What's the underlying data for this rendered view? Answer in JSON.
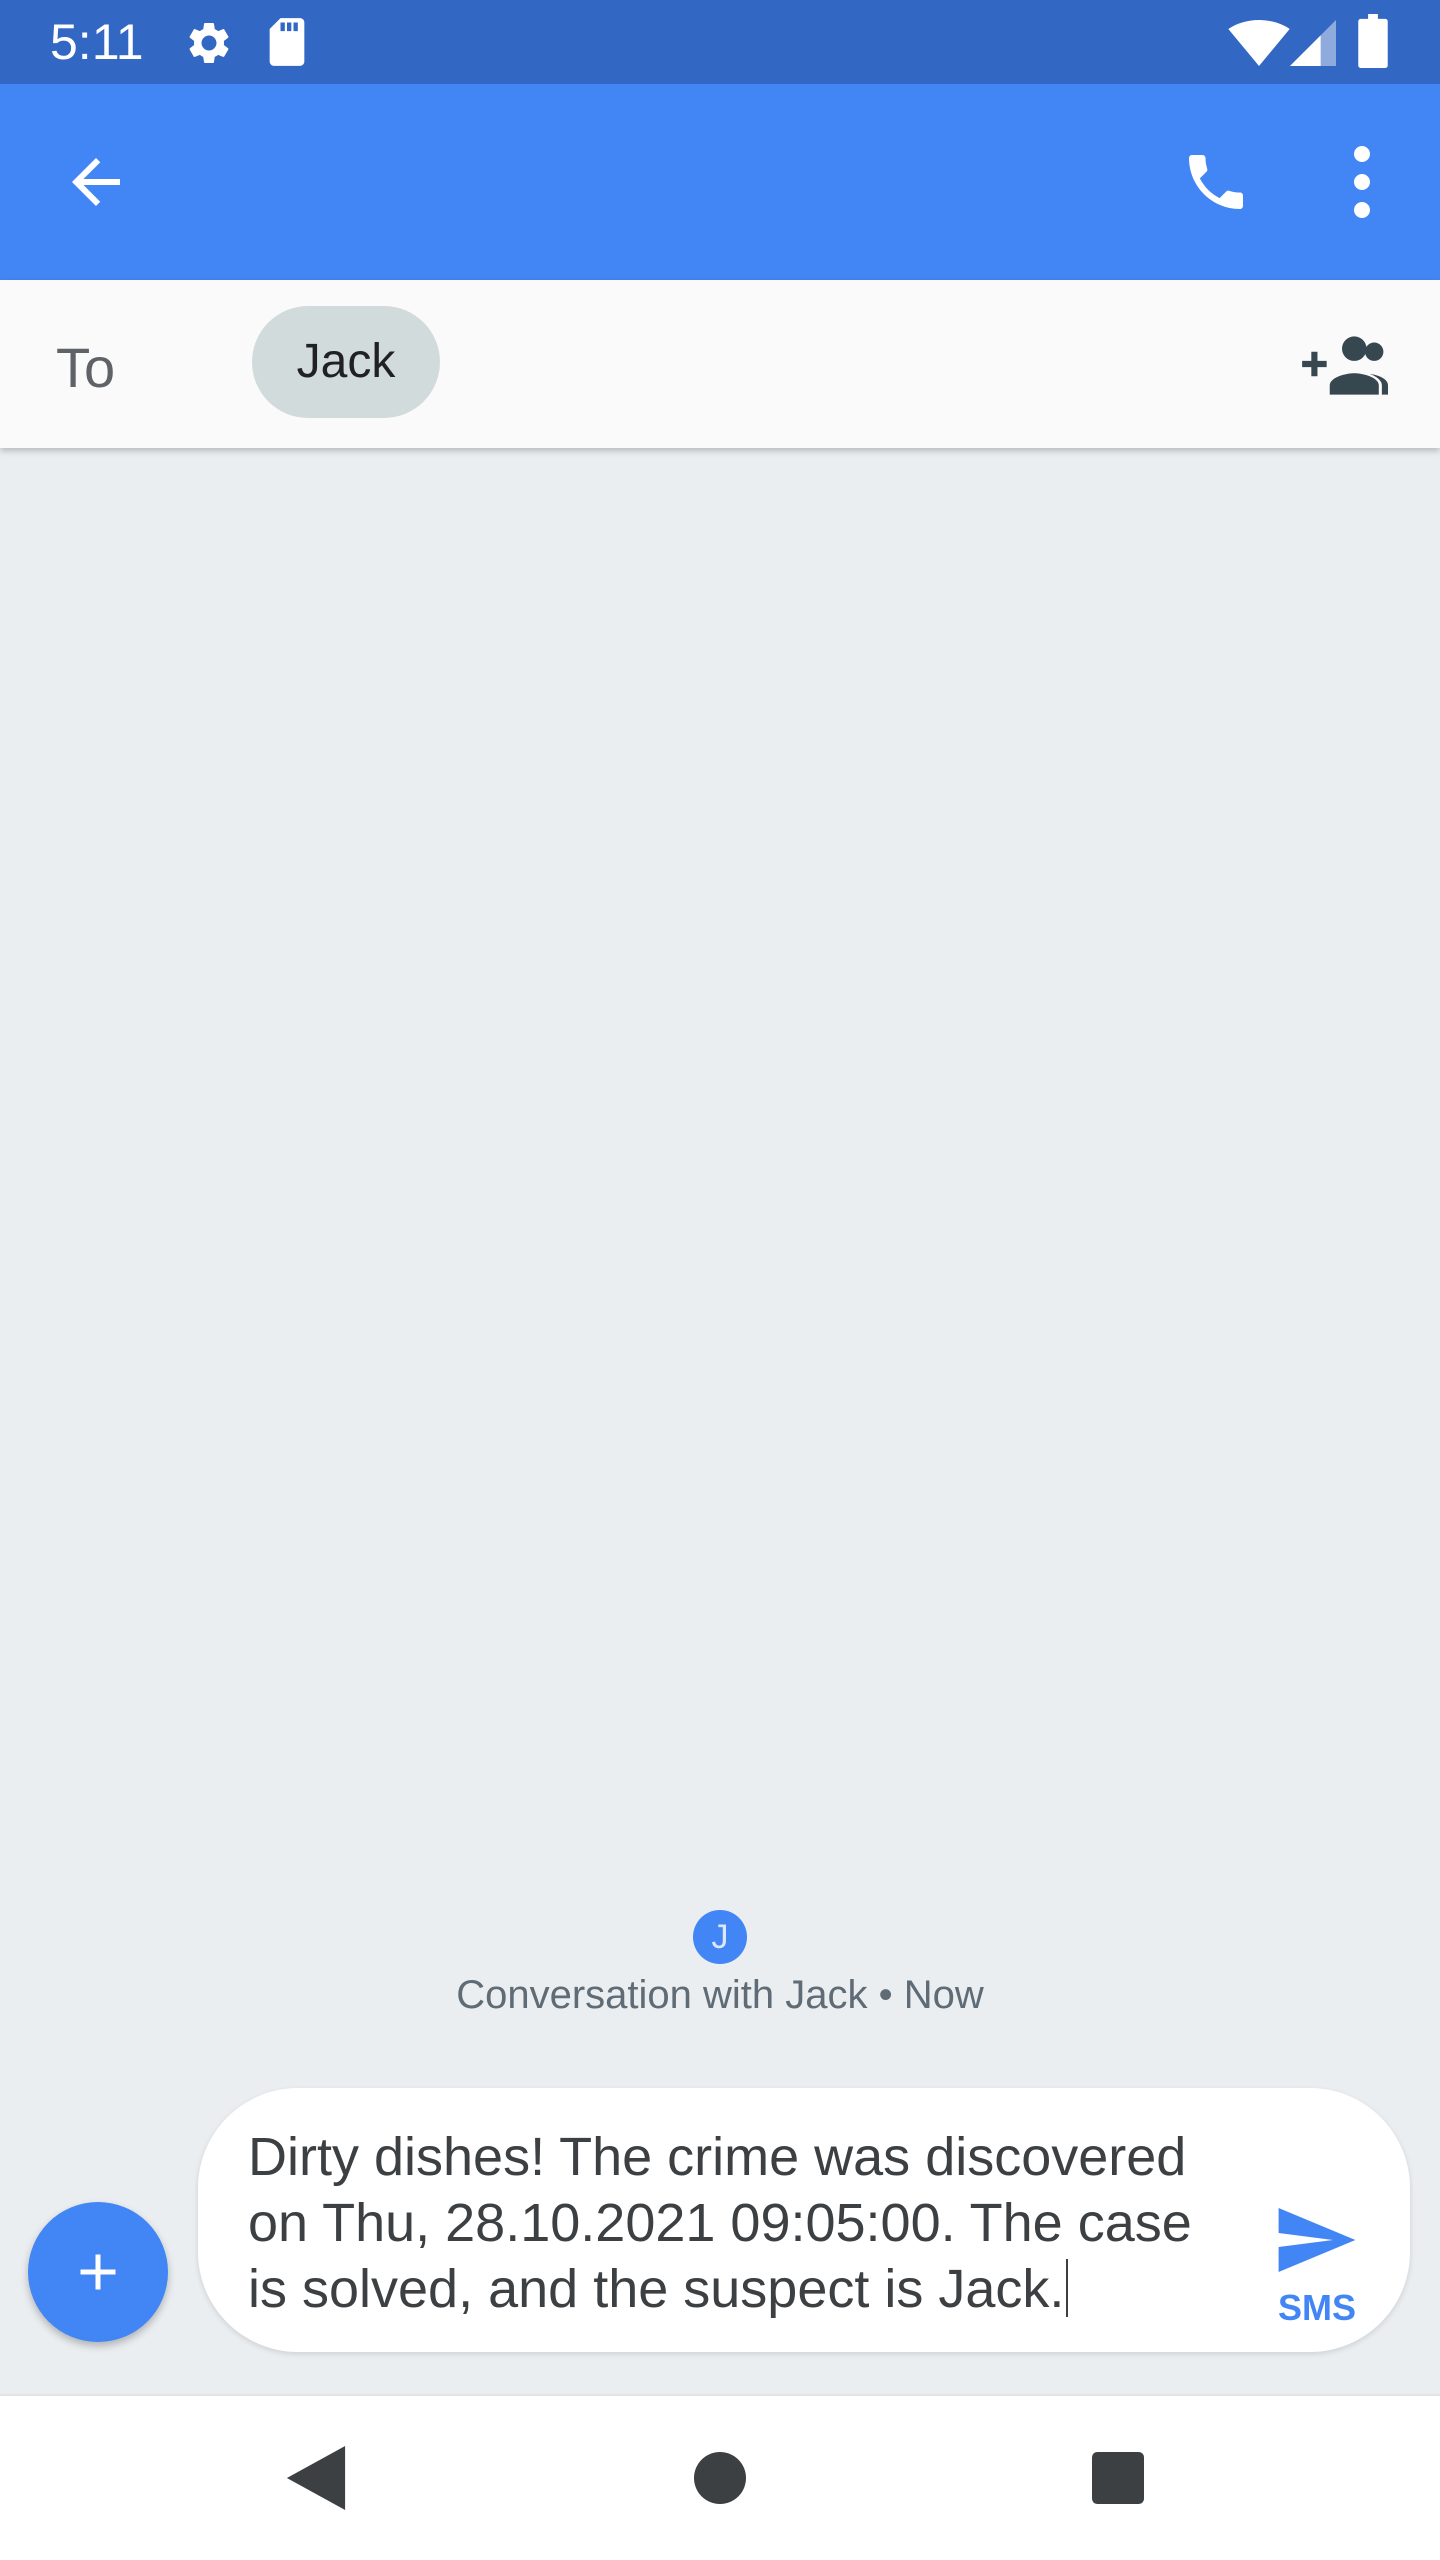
{
  "status_bar": {
    "time": "5:11",
    "icons": [
      "gear-icon",
      "sd-card-icon",
      "wifi-icon",
      "cell-signal-icon",
      "battery-icon"
    ]
  },
  "app_bar": {
    "color": "#4285f4",
    "icons": [
      "back-arrow-icon",
      "phone-icon",
      "more-vert-icon"
    ]
  },
  "recipient": {
    "to_label": "To",
    "chip_name": "Jack",
    "add_icon": "add-group-icon"
  },
  "conversation": {
    "avatar_letter": "J",
    "info": "Conversation with Jack • Now"
  },
  "compose": {
    "text": "Dirty dishes! The crime was discovered on Thu, 28.10.2021 09:05:00. The case is solved, and the suspect is Jack.",
    "send_label": "SMS",
    "attach_icon": "plus-icon",
    "send_icon": "send-icon"
  },
  "nav_bar": {
    "icons": [
      "nav-back-icon",
      "nav-home-icon",
      "nav-recents-icon"
    ]
  },
  "colors": {
    "status_bar": "#3367c4",
    "accent": "#4285f4",
    "background": "#eaeef1"
  }
}
